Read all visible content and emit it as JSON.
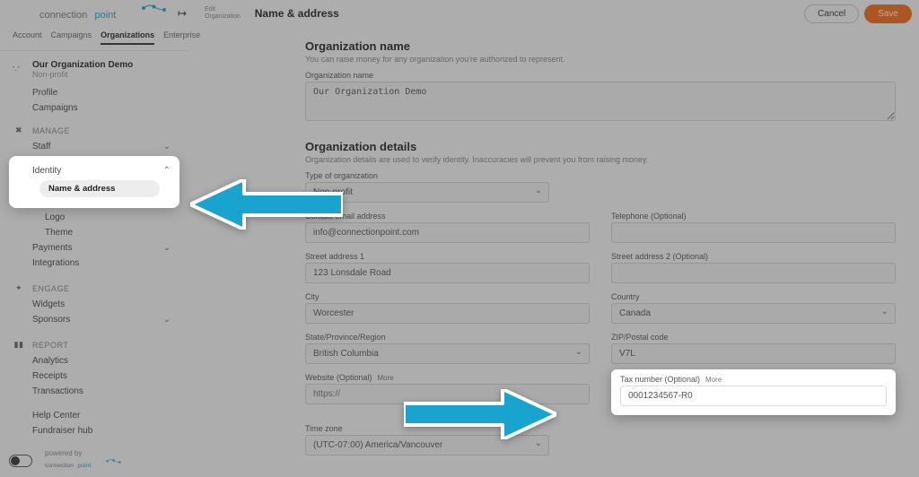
{
  "header": {
    "breadcrumb_l1": "Edit",
    "breadcrumb_l2": "Organization",
    "page_title": "Name & address",
    "cancel": "Cancel",
    "save": "Save"
  },
  "topnav": {
    "account": "Account",
    "campaigns": "Campaigns",
    "organizations": "Organizations",
    "enterprise": "Enterprise"
  },
  "org": {
    "name": "Our Organization Demo",
    "type": "Non-profit"
  },
  "sidebar": {
    "profile": "Profile",
    "campaigns": "Campaigns",
    "manage": "MANAGE",
    "staff": "Staff",
    "identity": "Identity",
    "name_address": "Name & address",
    "logo": "Logo",
    "theme": "Theme",
    "payments": "Payments",
    "integrations": "Integrations",
    "engage": "ENGAGE",
    "widgets": "Widgets",
    "sponsors": "Sponsors",
    "report": "REPORT",
    "analytics": "Analytics",
    "receipts": "Receipts",
    "transactions": "Transactions",
    "help_center": "Help Center",
    "fundraiser_hub": "Fundraiser hub",
    "powered_by": "powered by"
  },
  "form": {
    "org_name_h": "Organization name",
    "org_name_hint": "You can raise money for any organization you're authorized to represent.",
    "org_name_lbl": "Organization name",
    "org_name_val": "Our Organization Demo",
    "details_h": "Organization details",
    "details_hint": "Organization details are used to verify identity. Inaccuracies will prevent you from raising money.",
    "type_lbl": "Type of organization",
    "type_val": "Non-profit",
    "email_lbl": "Contact email address",
    "email_val": "info@connectionpoint.com",
    "tel_lbl": "Telephone (Optional)",
    "tel_val": "",
    "addr1_lbl": "Street address 1",
    "addr1_val": "123 Lonsdale Road",
    "addr2_lbl": "Street address 2 (Optional)",
    "addr2_val": "",
    "city_lbl": "City",
    "city_val": "Worcester",
    "country_lbl": "Country",
    "country_val": "Canada",
    "state_lbl": "State/Province/Region",
    "state_val": "British Columbia",
    "zip_lbl": "ZIP/Postal code",
    "zip_val": "V7L",
    "website_lbl": "Website (Optional)",
    "website_more": "More",
    "website_placeholder": "https://",
    "tax_lbl": "Tax number (Optional)",
    "tax_more": "More",
    "tax_val": "0001234567-R0",
    "tz_lbl": "Time zone",
    "tz_val": "(UTC-07:00) America/Vancouver"
  }
}
